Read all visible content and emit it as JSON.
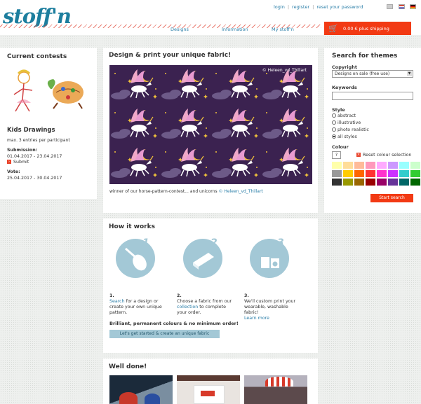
{
  "header": {
    "logo": "stoff'n",
    "links": {
      "login": "login",
      "register": "register",
      "reset": "reset your password"
    },
    "nav": {
      "designs": "Designs",
      "information": "Information",
      "mystoff": "My stoff'n"
    },
    "cart_text": "0.00 € plus shipping"
  },
  "contests": {
    "heading": "Current contests",
    "name": "Kids Drawings",
    "entries": "max. 3 entries per participant",
    "submission_label": "Submission:",
    "submission_dates": "01.04.2017 - 23.04.2017",
    "submit": "Submit",
    "vote_label": "Vote:",
    "vote_dates": "25.04.2017 - 30.04.2017"
  },
  "feature": {
    "heading": "Design & print your unique fabric!",
    "watermark": "© Heleen_vd_Thillart",
    "credit_text": "winner of our horse-pattern-contest... and unicorns ",
    "credit_link": "© Heleen_vd_Thillart"
  },
  "search": {
    "heading": "Search for themes",
    "copyright_label": "Copyright",
    "copyright_value": "Designs on sale (free use)",
    "keywords_label": "Keywords",
    "style_label": "Style",
    "styles": [
      "abstract",
      "illustrative",
      "photo realistic",
      "all styles"
    ],
    "colour_label": "Colour",
    "colour_value": "?",
    "reset": "Reset colour selection",
    "palette": [
      "#ffffaa",
      "#ffdd99",
      "#ffbb99",
      "#ff99bb",
      "#ffaaff",
      "#cc99ff",
      "#99ffff",
      "#ccffcc",
      "#999999",
      "#ffcc00",
      "#ff6600",
      "#ff3333",
      "#ff33cc",
      "#cc33ff",
      "#33cccc",
      "#33cc33",
      "#333333",
      "#999900",
      "#996600",
      "#990000",
      "#990066",
      "#663399",
      "#006666",
      "#006600"
    ],
    "button": "Start search"
  },
  "how": {
    "heading": "How it works",
    "steps": [
      {
        "num": "1.",
        "link": "Search",
        "text": " for a design or create your own unique pattern."
      },
      {
        "num": "2.",
        "pre": "Choose a fabric from our ",
        "link": "collection",
        "text": " to complete your order."
      },
      {
        "num": "3.",
        "text": "We'll custom print your wearable, washable fabric!",
        "link": "Learn more"
      }
    ],
    "brilliant": "Brilliant, permanent colours & no minimum order!",
    "button": "Let's get started & create an unique fabric"
  },
  "done": {
    "heading": "Well done!"
  }
}
